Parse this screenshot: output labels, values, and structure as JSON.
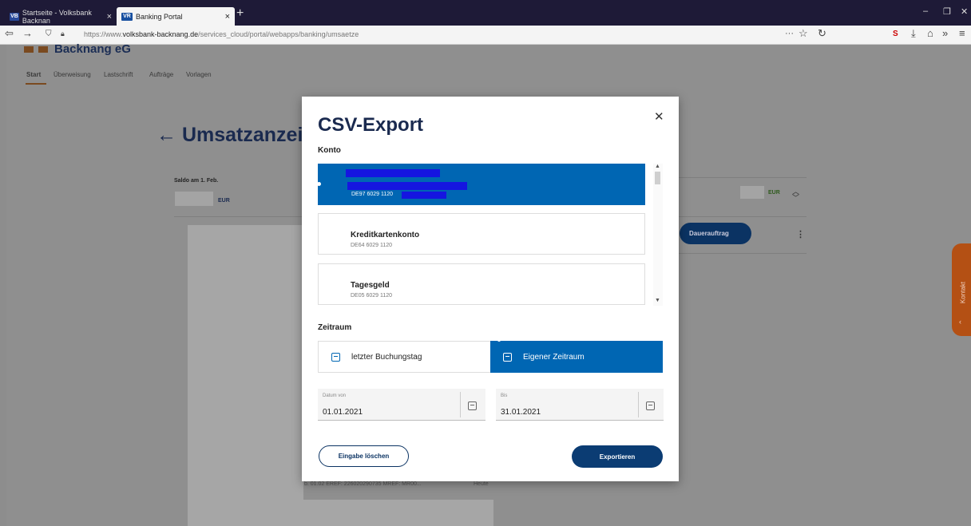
{
  "browser": {
    "tabs": [
      {
        "label": "Startseite - Volksbank Backnan"
      },
      {
        "label": "Banking Portal"
      }
    ],
    "url_prefix": "https://www.",
    "url_domain": "volksbank-backnang.de",
    "url_path": "/services_cloud/portal/webapps/banking/umsaetze"
  },
  "page": {
    "bank_name": "Backnang eG",
    "subnav": [
      "Start",
      "Überweisung",
      "Lastschrift",
      "Aufträge",
      "Vorlagen"
    ],
    "title": "← Umsatzanzeige",
    "saldo_label": "Saldo am 1. Feb.",
    "currency": "EUR",
    "dauerauftrag_label": "Dauerauftrag",
    "bg_row_text": "b. 01.02 EREF: 226020290735 MREF: MR00...",
    "bg_row_date": "Heute",
    "kontakt_label": "Kontakt"
  },
  "modal": {
    "title": "CSV-Export",
    "konto_label": "Konto",
    "accounts": [
      {
        "name": "",
        "iban": "DE97 6029 1120",
        "selected": true
      },
      {
        "name": "Kreditkartenkonto",
        "iban": "DE64 6029 1120",
        "selected": false
      },
      {
        "name": "Tagesgeld",
        "iban": "DE05 6029 1120",
        "selected": false
      }
    ],
    "zeitraum_label": "Zeitraum",
    "option_last_day": "letzter Buchungstag",
    "option_custom": "Eigener Zeitraum",
    "date_from_label": "Datum von",
    "date_from": "01.01.2021",
    "date_to_label": "Bis",
    "date_to": "31.01.2021",
    "clear_label": "Eingabe löschen",
    "export_label": "Exportieren"
  }
}
